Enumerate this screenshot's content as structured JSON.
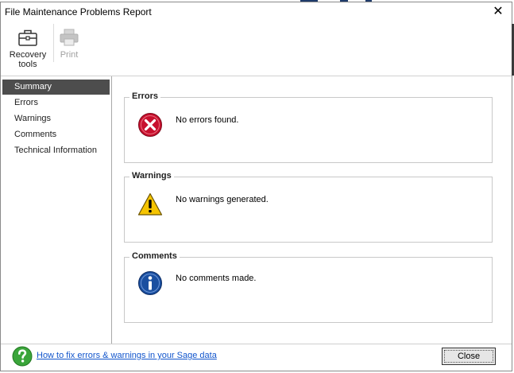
{
  "window": {
    "title": "File Maintenance Problems Report",
    "close_glyph": "✕"
  },
  "toolbar": {
    "items": [
      {
        "label_line1": "Recovery",
        "label_line2": "tools",
        "icon": "toolbox-icon",
        "enabled": true
      },
      {
        "label_line1": "Print",
        "icon": "printer-icon",
        "enabled": false
      }
    ]
  },
  "sidebar": {
    "items": [
      {
        "label": "Summary",
        "selected": true
      },
      {
        "label": "Errors"
      },
      {
        "label": "Warnings"
      },
      {
        "label": "Comments"
      },
      {
        "label": "Technical Information"
      }
    ]
  },
  "sections": {
    "errors": {
      "title": "Errors",
      "message": "No errors found.",
      "icon": "error-icon"
    },
    "warnings": {
      "title": "Warnings",
      "message": "No warnings generated.",
      "icon": "warning-icon"
    },
    "comments": {
      "title": "Comments",
      "message": "No comments made.",
      "icon": "info-icon"
    }
  },
  "footer": {
    "help_link": "How to fix errors & warnings in your Sage data",
    "help_icon": "help-icon",
    "close_label": "Close"
  },
  "colors": {
    "selected_bg": "#4d4d4d",
    "link": "#1155cc",
    "error_red": "#c8102e",
    "warning_yellow": "#f5c400",
    "info_blue": "#1a4fa0",
    "help_green": "#3aa53a"
  }
}
